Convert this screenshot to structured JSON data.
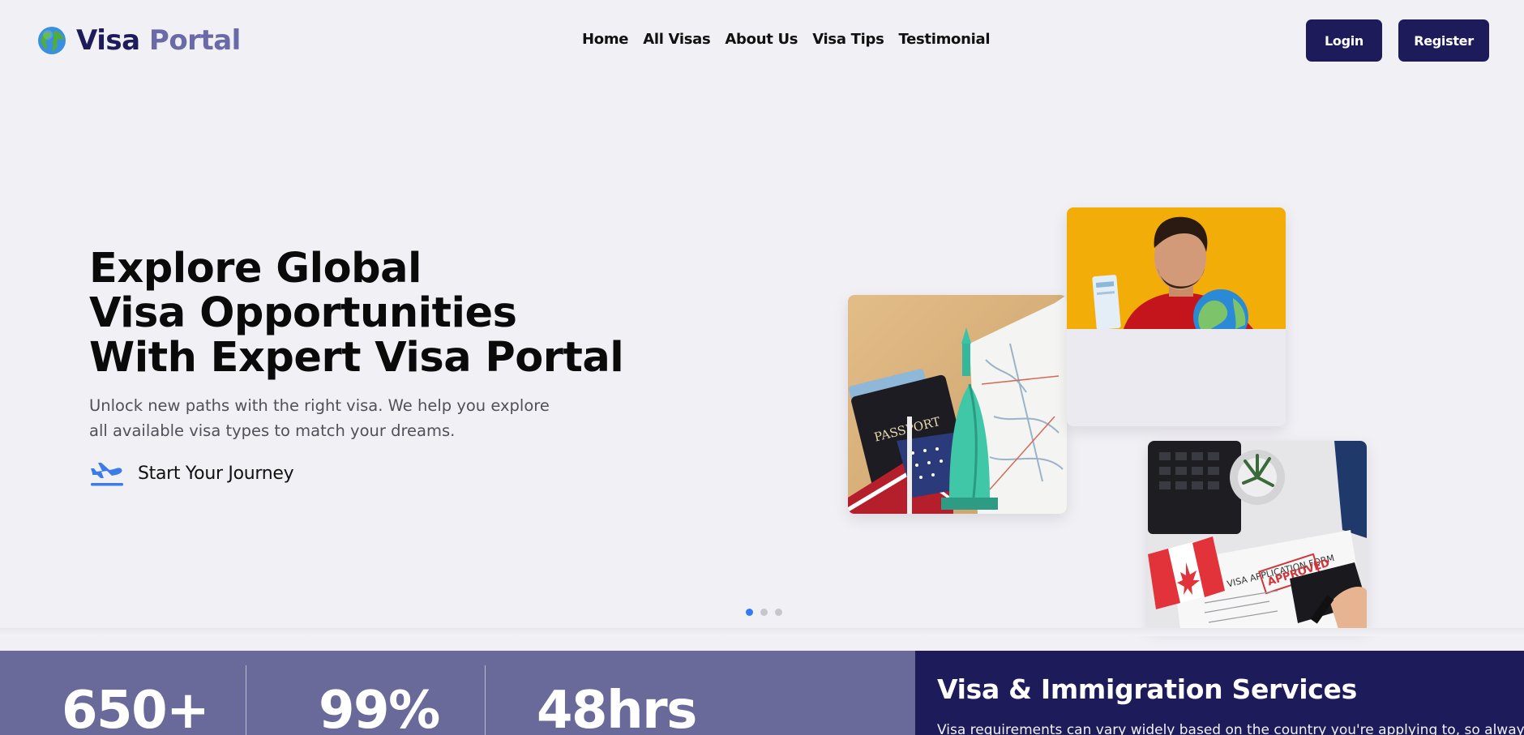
{
  "nav": {
    "brand_first": "Visa",
    "brand_second": "Portal",
    "links": [
      "Home",
      "All Visas",
      "About Us",
      "Visa Tips",
      "Testimonial"
    ],
    "login_label": "Login",
    "register_label": "Register"
  },
  "hero": {
    "title_lines": [
      "Explore Global",
      "Visa Opportunities",
      "With Expert Visa Portal"
    ],
    "description": "Unlock new paths with the right visa. We help you explore all available visa types to match your dreams.",
    "cta_label": "Start Your Journey",
    "slide_count": 3,
    "active_slide": 1,
    "image_labels": {
      "passport": "PASSPORT",
      "form": "VISA APPLICATION FORM",
      "stamp": "APPROVED"
    }
  },
  "stats": {
    "items": [
      {
        "value": "650+"
      },
      {
        "value": "99%"
      },
      {
        "value": "48hrs"
      }
    ]
  },
  "services": {
    "title": "Visa & Immigration Services",
    "text": "Visa requirements can vary widely based on the country you're applying to, so always"
  },
  "colors": {
    "brand_dark": "#1d1b5a",
    "brand_muted": "#6a6aa8",
    "stats_bg": "#6a6a9a",
    "dot_active": "#2f7cf6",
    "page_bg": "#f1f0f5"
  },
  "icons": [
    "globe-icon",
    "airplane-icon"
  ]
}
